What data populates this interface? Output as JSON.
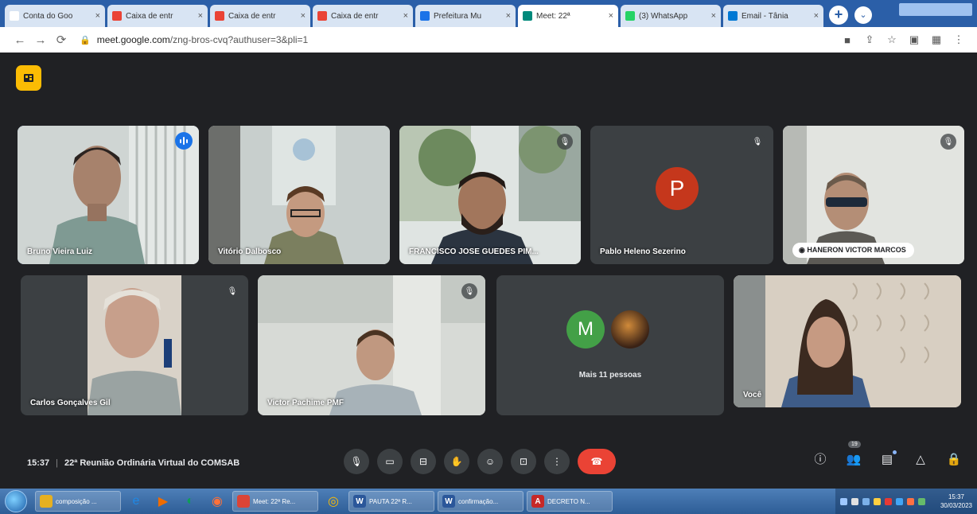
{
  "browser": {
    "tabs": [
      {
        "label": "Conta do Goo",
        "icon": "google-icon",
        "color": "#ffffff",
        "active": false
      },
      {
        "label": "Caixa de entr",
        "icon": "gmail-icon",
        "color": "#ea4335",
        "active": false
      },
      {
        "label": "Caixa de entr",
        "icon": "gmail-icon",
        "color": "#ea4335",
        "active": false
      },
      {
        "label": "Caixa de entr",
        "icon": "gmail-icon",
        "color": "#ea4335",
        "active": false
      },
      {
        "label": "Prefeitura Mu",
        "icon": "page-icon",
        "color": "#1a73e8",
        "active": false
      },
      {
        "label": "Meet: 22ª",
        "icon": "meet-icon",
        "color": "#00897b",
        "active": true
      },
      {
        "label": "(3) WhatsApp",
        "icon": "whatsapp-icon",
        "color": "#25d366",
        "active": false
      },
      {
        "label": "Email - Tânia",
        "icon": "outlook-icon",
        "color": "#0078d4",
        "active": false
      }
    ],
    "url_host": "meet.google.com",
    "url_path": "/zng-bros-cvq?authuser=3&pli=1"
  },
  "participants": [
    {
      "name": "Bruno Vieira Luiz",
      "speaking": true
    },
    {
      "name": "Vitório Dalbosco",
      "muted": false
    },
    {
      "name": "FRANCISCO JOSE GUEDES PIM...",
      "muted": true
    },
    {
      "name": "Pablo Heleno Sezerino",
      "muted": true,
      "initial": "P",
      "avatar_color": "#c5371c"
    },
    {
      "name": "HANERON VICTOR MARCOS",
      "muted": true,
      "pinned_label": true
    },
    {
      "name": "Carlos Gonçalves Gil",
      "muted": true
    },
    {
      "name": "Victor Pachime PMF",
      "muted": true
    },
    {
      "name": "Você",
      "muted": false
    }
  ],
  "more_people": {
    "initial": "M",
    "avatar_color": "#43a047",
    "label": "Mais 11 pessoas"
  },
  "meeting": {
    "time": "15:37",
    "title": "22ª Reunião Ordinária Virtual do COMSAB"
  },
  "controls": [
    "mic-icon",
    "camera-icon",
    "captions-icon",
    "raise-hand-icon",
    "emoji-icon",
    "present-icon",
    "more-options-icon",
    "leave-call-icon"
  ],
  "right_controls": {
    "participant_count": "19"
  },
  "taskbar": {
    "items": [
      {
        "label": "composição ...",
        "color": "#e6b020"
      },
      {
        "label": "Meet: 22ª Re...",
        "color": "#db4437"
      },
      {
        "label": "PAUTA 22ª R...",
        "color": "#2b579a",
        "glyph": "W"
      },
      {
        "label": "confirmação...",
        "color": "#2b579a",
        "glyph": "W"
      },
      {
        "label": "DECRETO N...",
        "color": "#c62828",
        "glyph": "A"
      }
    ],
    "clock_time": "15:37",
    "clock_date": "30/03/2023"
  }
}
